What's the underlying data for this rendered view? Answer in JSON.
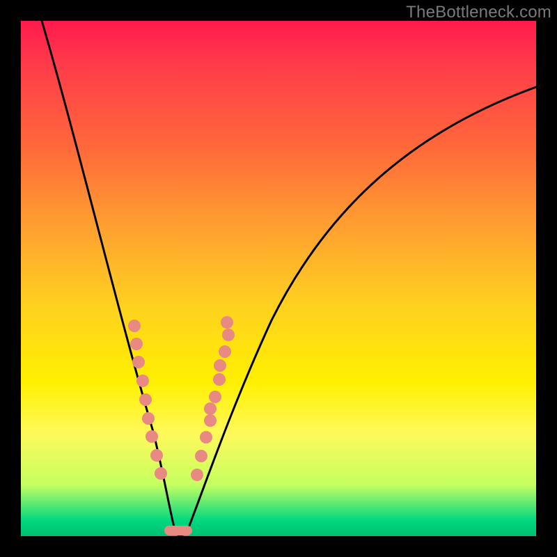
{
  "watermark": "TheBottleneck.com",
  "chart_data": {
    "type": "line",
    "title": "",
    "xlabel": "",
    "ylabel": "",
    "xlim": [
      0,
      100
    ],
    "ylim": [
      0,
      100
    ],
    "series": [
      {
        "name": "curve",
        "x": [
          4,
          8,
          12,
          16,
          20,
          23,
          25,
          27,
          29,
          30,
          32,
          36,
          40,
          46,
          52,
          60,
          70,
          82,
          94,
          100
        ],
        "values": [
          100,
          87,
          74,
          60,
          46,
          33,
          21,
          10,
          3,
          0,
          3,
          12,
          24,
          38,
          50,
          61,
          72,
          80,
          86,
          88
        ]
      }
    ],
    "dot_clusters": {
      "left": {
        "x_range": [
          21,
          27
        ],
        "y_range": [
          17,
          41
        ],
        "count": 9
      },
      "right": {
        "x_range": [
          33,
          39
        ],
        "y_range": [
          12,
          40
        ],
        "count": 11
      }
    },
    "bottom_marker": {
      "x_range": [
        27,
        32
      ],
      "y": 1
    }
  }
}
